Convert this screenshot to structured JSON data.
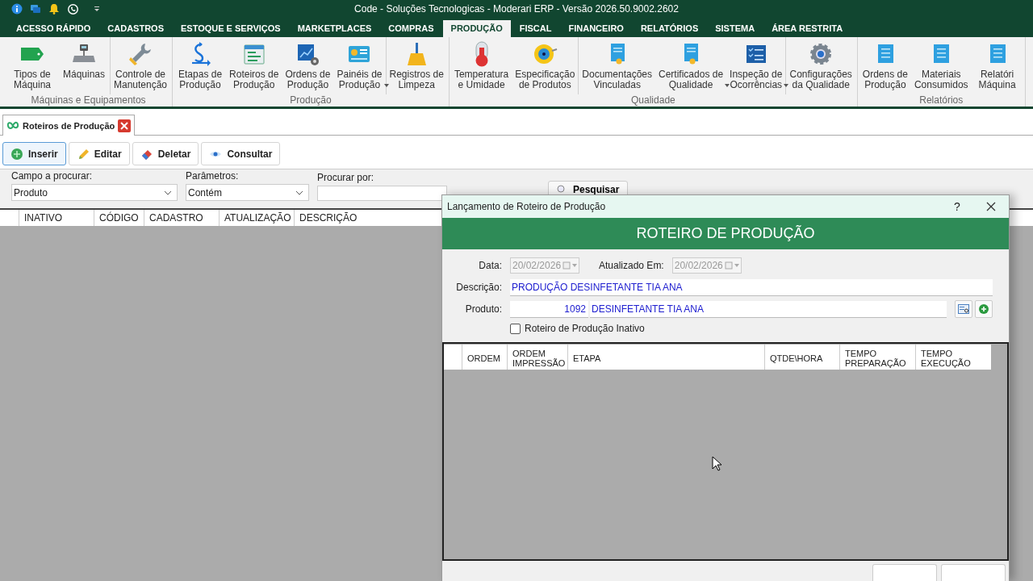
{
  "window": {
    "title": "Code - Soluções Tecnologicas - Moderari ERP - Versão 2026.50.9002.2602"
  },
  "menu_tabs": [
    {
      "label": "ACESSO RÁPIDO",
      "selected": false
    },
    {
      "label": "CADASTROS",
      "selected": false
    },
    {
      "label": "ESTOQUE E SERVIÇOS",
      "selected": false
    },
    {
      "label": "MARKETPLACES",
      "selected": false
    },
    {
      "label": "COMPRAS",
      "selected": false
    },
    {
      "label": "PRODUÇÃO",
      "selected": true
    },
    {
      "label": "FISCAL",
      "selected": false
    },
    {
      "label": "FINANCEIRO",
      "selected": false
    },
    {
      "label": "RELATÓRIOS",
      "selected": false
    },
    {
      "label": "SISTEMA",
      "selected": false
    },
    {
      "label": "ÁREA RESTRITA",
      "selected": false
    }
  ],
  "ribbon": [
    {
      "label": "Máquinas e Equipamentos",
      "sections": [
        [
          {
            "label": "Tipos de\nMáquina",
            "dropdown": false
          },
          {
            "label": "Máquinas",
            "dropdown": false
          }
        ],
        [
          {
            "label": "Controle de\nManutenção",
            "dropdown": false
          }
        ]
      ]
    },
    {
      "label": "Produção",
      "sections": [
        [
          {
            "label": "Etapas de\nProdução",
            "dropdown": false
          },
          {
            "label": "Roteiros de\nProdução",
            "dropdown": false
          },
          {
            "label": "Ordens de\nProdução",
            "dropdown": false
          },
          {
            "label": "Painéis de\nProdução",
            "dropdown": true
          }
        ],
        [
          {
            "label": "Registros de\nLimpeza",
            "dropdown": false
          }
        ]
      ]
    },
    {
      "label": "Qualidade",
      "sections": [
        [
          {
            "label": "Temperatura\ne Umidade",
            "dropdown": false
          },
          {
            "label": "Especificação\nde Produtos",
            "dropdown": false
          }
        ],
        [
          {
            "label": "Documentações\nVinculadas",
            "dropdown": false
          },
          {
            "label": "Certificados de\nQualidade",
            "dropdown": true
          },
          {
            "label": "Inspeção de\nOcorrências",
            "dropdown": true
          }
        ],
        [
          {
            "label": "Configurações\nda Qualidade",
            "dropdown": false
          }
        ]
      ]
    },
    {
      "label": "Relatórios",
      "sections": [
        [
          {
            "label": "Ordens de\nProdução",
            "dropdown": false
          },
          {
            "label": "Materiais\nConsumidos",
            "dropdown": false
          },
          {
            "label": "Relatóri\nMáquina",
            "dropdown": false
          }
        ]
      ]
    }
  ],
  "document_tab": {
    "label": "Roteiros de Produção"
  },
  "toolbar": [
    "Inserir",
    "Editar",
    "Deletar",
    "Consultar"
  ],
  "search": {
    "fields": [
      {
        "label": "Campo a procurar:",
        "value": "Produto",
        "kind": "select"
      },
      {
        "label": "Parâmetros:",
        "value": "Contém",
        "kind": "select"
      },
      {
        "label": "Procurar por:",
        "kind": "input"
      }
    ],
    "button": "Pesquisar"
  },
  "table": {
    "columns": [
      "INATIVO",
      "CÓDIGO",
      "CADASTRO",
      "ATUALIZAÇÃO",
      "DESCRIÇÃO"
    ]
  },
  "dialog": {
    "title": "Lançamento de Roteiro de Produção",
    "help": "?",
    "header": "ROTEIRO DE PRODUÇÃO",
    "date": {
      "label": "Data:",
      "value": "20/02/2026",
      "disabled": true
    },
    "updated": {
      "label": "Atualizado Em:",
      "value": "20/02/2026",
      "disabled": true
    },
    "description": {
      "label": "Descrição:",
      "value": "PRODUÇÃO DESINFETANTE TIA ANA"
    },
    "product": {
      "label": "Produto:",
      "code": "1092",
      "name": "DESINFETANTE TIA ANA"
    },
    "inactive": {
      "label": "Roteiro de Produção Inativo",
      "checked": false
    },
    "columns": [
      "ORDEM",
      "ORDEM\nIMPRESSÃO",
      "ETAPA",
      "QTDE\\HORA",
      "TEMPO\nPREPARAÇÃO",
      "TEMPO\nEXECUÇÃO"
    ]
  }
}
